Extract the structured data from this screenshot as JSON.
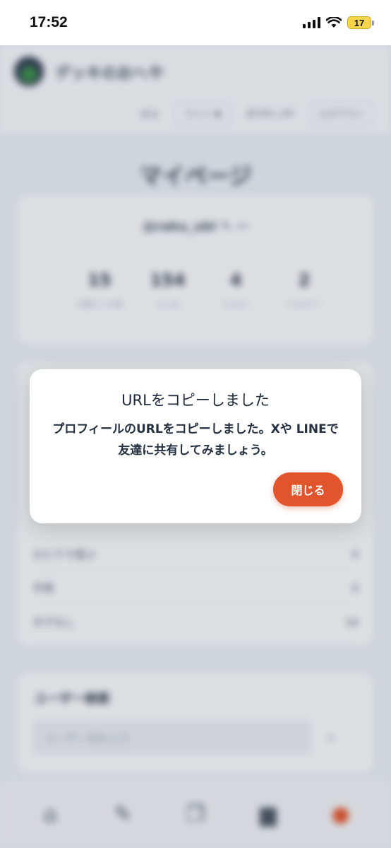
{
  "status_bar": {
    "time": "17:52",
    "battery": "17"
  },
  "background": {
    "brand": "デッキのおへや",
    "nav": [
      "戻る",
      "ライト ▼",
      "@raku_ubi",
      "ログアウト"
    ],
    "page_title": "マイページ",
    "profile": {
      "username": "@raku_ubi ✎ ⋯",
      "stats": [
        {
          "num": "15",
          "label": "公開デッキ数"
        },
        {
          "num": "154",
          "label": "いいね"
        },
        {
          "num": "4",
          "label": "フォロー"
        },
        {
          "num": "2",
          "label": "フォロワー"
        }
      ]
    },
    "list_rows": [
      {
        "label": "ひとりで遊ぶ",
        "value": "0"
      },
      {
        "label": "不明",
        "value": "0"
      },
      {
        "label": "タグなし",
        "value": "14"
      }
    ],
    "search": {
      "title": "ユーザー検索",
      "placeholder": "ユーザー名を入力"
    }
  },
  "dialog": {
    "title": "URLをコピーしました",
    "message": "プロフィールのURLをコピーしました。Xや LINEで友達に共有してみましょう。",
    "close_label": "閉じる"
  }
}
